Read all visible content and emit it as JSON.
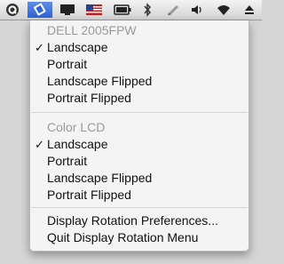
{
  "menubar": {
    "icons": [
      "q-icon",
      "display-rotation-icon",
      "monitor-icon",
      "us-flag-icon",
      "battery-icon",
      "bluetooth-icon",
      "pen-icon",
      "volume-icon",
      "wifi-icon",
      "eject-icon"
    ]
  },
  "menu": {
    "groups": [
      {
        "header": "DELL 2005FPW",
        "items": [
          {
            "label": "Landscape",
            "checked": true
          },
          {
            "label": "Portrait",
            "checked": false
          },
          {
            "label": "Landscape Flipped",
            "checked": false
          },
          {
            "label": "Portrait Flipped",
            "checked": false
          }
        ]
      },
      {
        "header": "Color LCD",
        "items": [
          {
            "label": "Landscape",
            "checked": true
          },
          {
            "label": "Portrait",
            "checked": false
          },
          {
            "label": "Landscape Flipped",
            "checked": false
          },
          {
            "label": "Portrait Flipped",
            "checked": false
          }
        ]
      }
    ],
    "actions": [
      {
        "label": "Display Rotation Preferences..."
      },
      {
        "label": "Quit Display Rotation Menu"
      }
    ],
    "check_glyph": "✓"
  },
  "colors": {
    "menubar_active": "#2a63d6",
    "header_text": "#9a9a9a"
  }
}
